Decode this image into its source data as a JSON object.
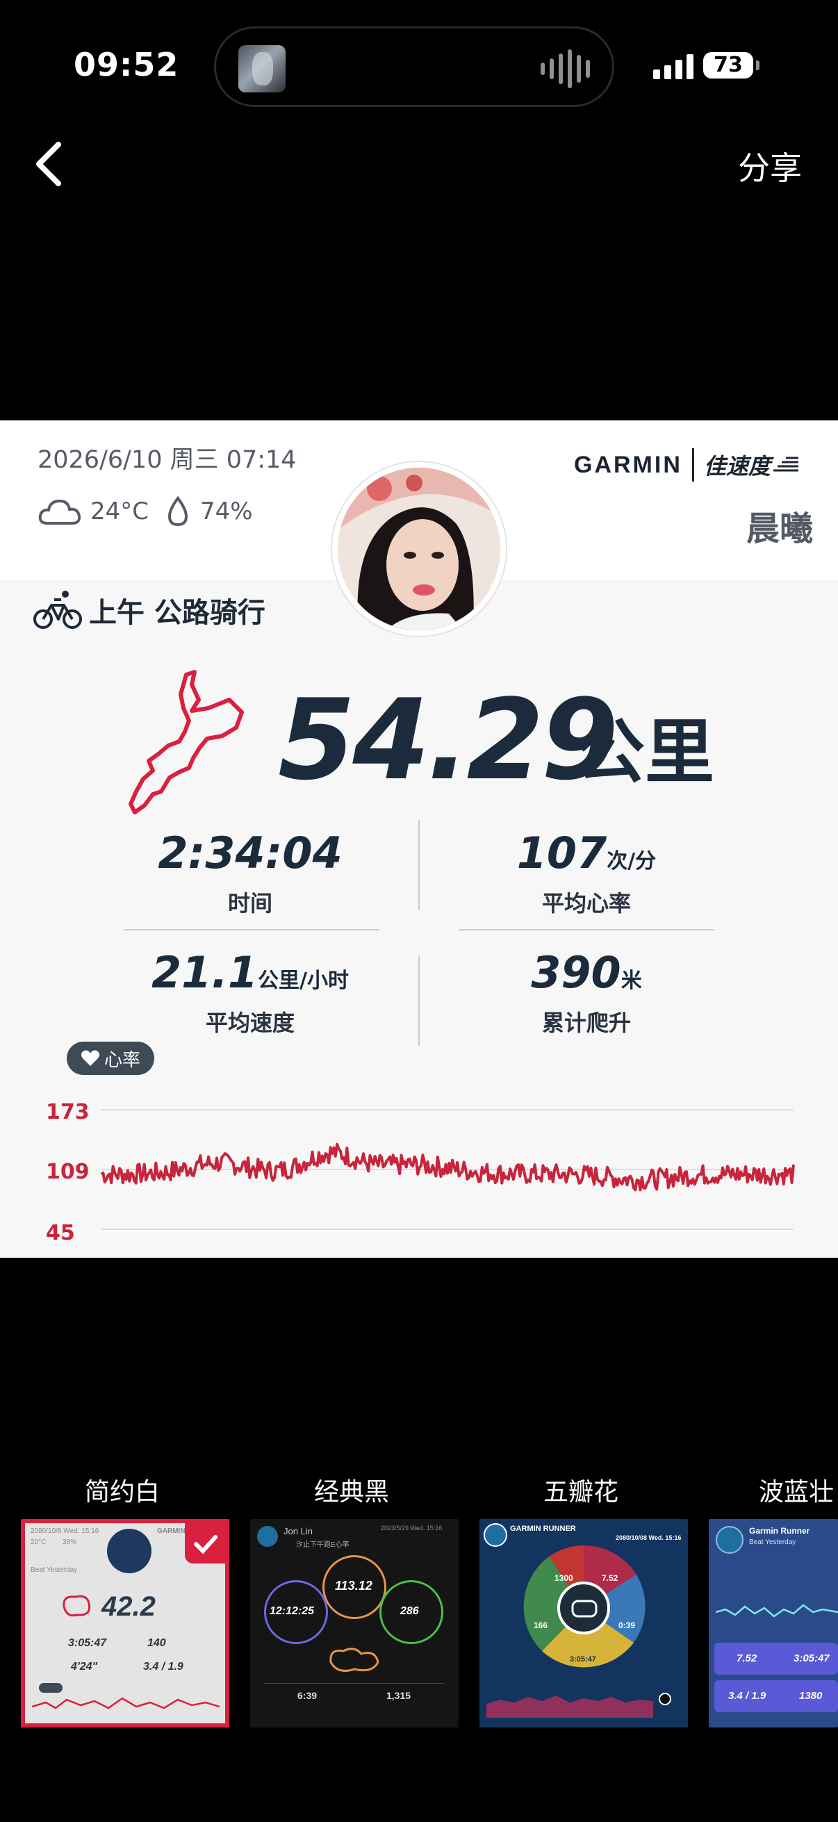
{
  "status_bar": {
    "time": "09:52",
    "battery": "73"
  },
  "nav": {
    "share": "分享"
  },
  "card": {
    "date": "2026/6/10 周三 07:14",
    "weather": {
      "temp": "24°C",
      "humidity": "74%"
    },
    "brand": {
      "garmin": "GARMIN",
      "partner": "佳速度"
    },
    "user_name": "晨曦",
    "activity": "上午 公路骑行",
    "distance": {
      "value": "54.29",
      "unit": "公里"
    },
    "stats": [
      {
        "value": "2:34:04",
        "unit": "",
        "label": "时间"
      },
      {
        "value": "107",
        "unit": "次/分",
        "label": "平均心率"
      },
      {
        "value": "21.1",
        "unit": "公里/小时",
        "label": "平均速度"
      },
      {
        "value": "390",
        "unit": "米",
        "label": "累计爬升"
      }
    ],
    "hr_badge": "心率",
    "hr_chart": {
      "yticks": [
        "173",
        "109",
        "45"
      ],
      "ylim": [
        45,
        173
      ],
      "line_color": "#c8243b"
    }
  },
  "templates": [
    {
      "label": "简约白",
      "selected": true,
      "preview": {
        "date": "2080/10/8 Wed. 15:16",
        "brand": "GARMIN",
        "beat": "Beat Yesterday",
        "temp": "20°C",
        "hum": "38%",
        "distance": "42.2",
        "time": "3:05:47",
        "hr": "140",
        "pace": "4'24\"",
        "speed": "3.4 / 1.9"
      }
    },
    {
      "label": "经典黑",
      "selected": false,
      "preview": {
        "name": "Jon Lin",
        "date": "2023/5/29 Wed. 15:16",
        "sub": "汐止下午跑E心率",
        "a": "113.12",
        "b": "12:12:25",
        "c": "286",
        "d": "6:39",
        "e": "1,315"
      }
    },
    {
      "label": "五瓣花",
      "selected": false,
      "preview": {
        "brand": "GARMIN RUNNER",
        "date": "2080/10/08 Wed. 15:16",
        "a": "1300",
        "b": "7.52",
        "c": "0:39",
        "d": "3:05:47",
        "e": "166"
      }
    },
    {
      "label": "波蓝壮",
      "selected": false,
      "preview": {
        "brand": "Garmin Runner",
        "beat": "Beat Yesterday",
        "a": "7.52",
        "b": "3:05:47",
        "c": "3.4 / 1.9",
        "d": "1380"
      }
    }
  ]
}
